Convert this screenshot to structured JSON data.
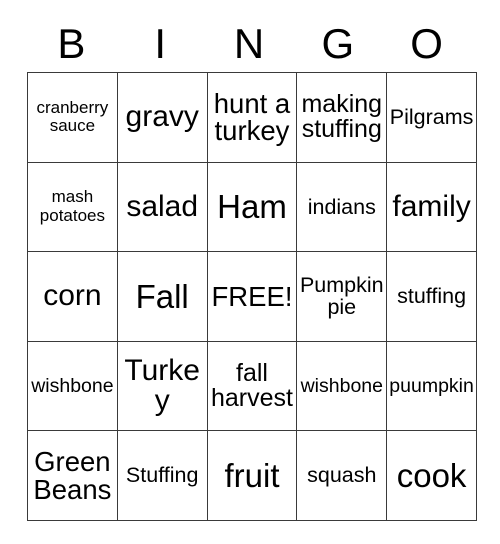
{
  "card": {
    "title": "BINGO",
    "columns": [
      "B",
      "I",
      "N",
      "G",
      "O"
    ],
    "free_space_label": "FREE!",
    "colors": {
      "border": "#3a3a3a",
      "text": "#000000",
      "background": "#ffffff"
    },
    "rows": [
      [
        {
          "text": "cranberry sauce",
          "size": "fs-sm"
        },
        {
          "text": "gravy",
          "size": "fs-3xl"
        },
        {
          "text": "hunt a turkey",
          "size": "fs-2xl"
        },
        {
          "text": "making stuffing",
          "size": "fs-xl"
        },
        {
          "text": "Pilgrams",
          "size": "fs-lg"
        }
      ],
      [
        {
          "text": "mash potatoes",
          "size": "fs-sm"
        },
        {
          "text": "salad",
          "size": "fs-3xl"
        },
        {
          "text": "Ham",
          "size": "fs-4xl"
        },
        {
          "text": "indians",
          "size": "fs-lg"
        },
        {
          "text": "family",
          "size": "fs-3xl"
        }
      ],
      [
        {
          "text": "corn",
          "size": "fs-3xl"
        },
        {
          "text": "Fall",
          "size": "fs-4xl"
        },
        {
          "text": "FREE!",
          "size": "fs-2xl"
        },
        {
          "text": "Pumpkin pie",
          "size": "fs-lg"
        },
        {
          "text": "stuffing",
          "size": "fs-lg"
        }
      ],
      [
        {
          "text": "wishbone",
          "size": "fs-md"
        },
        {
          "text": "Turkey",
          "size": "fs-3xl"
        },
        {
          "text": "fall harvest",
          "size": "fs-xl"
        },
        {
          "text": "wishbone",
          "size": "fs-md"
        },
        {
          "text": "puumpkin",
          "size": "fs-md"
        }
      ],
      [
        {
          "text": "Green Beans",
          "size": "fs-2xl"
        },
        {
          "text": "Stuffing",
          "size": "fs-lg"
        },
        {
          "text": "fruit",
          "size": "fs-4xl"
        },
        {
          "text": "squash",
          "size": "fs-lg"
        },
        {
          "text": "cook",
          "size": "fs-4xl"
        }
      ]
    ]
  }
}
